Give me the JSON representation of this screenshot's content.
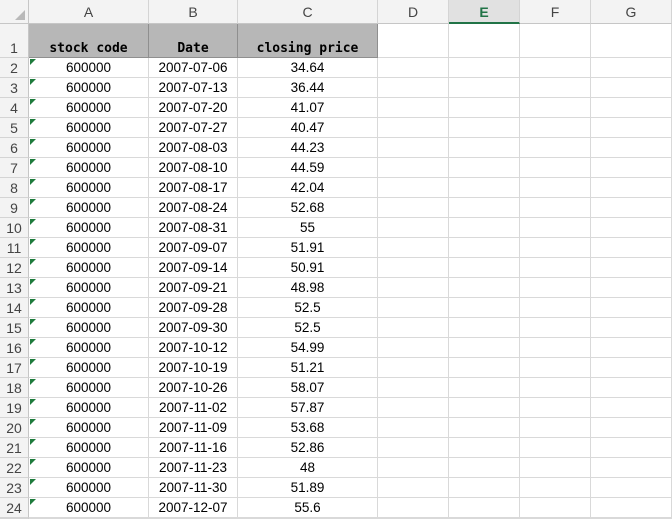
{
  "columns": [
    "A",
    "B",
    "C",
    "D",
    "E",
    "F",
    "G"
  ],
  "active_column": "E",
  "header_row": {
    "row_label": "1",
    "cells": [
      "stock code",
      "Date",
      "closing price"
    ]
  },
  "rows": [
    {
      "row": "2",
      "code": "600000",
      "date": "2007-07-06",
      "price": "34.64"
    },
    {
      "row": "3",
      "code": "600000",
      "date": "2007-07-13",
      "price": "36.44"
    },
    {
      "row": "4",
      "code": "600000",
      "date": "2007-07-20",
      "price": "41.07"
    },
    {
      "row": "5",
      "code": "600000",
      "date": "2007-07-27",
      "price": "40.47"
    },
    {
      "row": "6",
      "code": "600000",
      "date": "2007-08-03",
      "price": "44.23"
    },
    {
      "row": "7",
      "code": "600000",
      "date": "2007-08-10",
      "price": "44.59"
    },
    {
      "row": "8",
      "code": "600000",
      "date": "2007-08-17",
      "price": "42.04"
    },
    {
      "row": "9",
      "code": "600000",
      "date": "2007-08-24",
      "price": "52.68"
    },
    {
      "row": "10",
      "code": "600000",
      "date": "2007-08-31",
      "price": "55"
    },
    {
      "row": "11",
      "code": "600000",
      "date": "2007-09-07",
      "price": "51.91"
    },
    {
      "row": "12",
      "code": "600000",
      "date": "2007-09-14",
      "price": "50.91"
    },
    {
      "row": "13",
      "code": "600000",
      "date": "2007-09-21",
      "price": "48.98"
    },
    {
      "row": "14",
      "code": "600000",
      "date": "2007-09-28",
      "price": "52.5"
    },
    {
      "row": "15",
      "code": "600000",
      "date": "2007-09-30",
      "price": "52.5"
    },
    {
      "row": "16",
      "code": "600000",
      "date": "2007-10-12",
      "price": "54.99"
    },
    {
      "row": "17",
      "code": "600000",
      "date": "2007-10-19",
      "price": "51.21"
    },
    {
      "row": "18",
      "code": "600000",
      "date": "2007-10-26",
      "price": "58.07"
    },
    {
      "row": "19",
      "code": "600000",
      "date": "2007-11-02",
      "price": "57.87"
    },
    {
      "row": "20",
      "code": "600000",
      "date": "2007-11-09",
      "price": "53.68"
    },
    {
      "row": "21",
      "code": "600000",
      "date": "2007-11-16",
      "price": "52.86"
    },
    {
      "row": "22",
      "code": "600000",
      "date": "2007-11-23",
      "price": "48"
    },
    {
      "row": "23",
      "code": "600000",
      "date": "2007-11-30",
      "price": "51.89"
    },
    {
      "row": "24",
      "code": "600000",
      "date": "2007-12-07",
      "price": "55.6"
    }
  ],
  "colors": {
    "accent": "#217346",
    "header_fill": "#b7b7b7",
    "number_stored_as_text_marker": "#1e7b3c"
  },
  "icons": {
    "select_all": "select-all-triangle-icon",
    "cell_marker": "text-number-warning-icon"
  }
}
